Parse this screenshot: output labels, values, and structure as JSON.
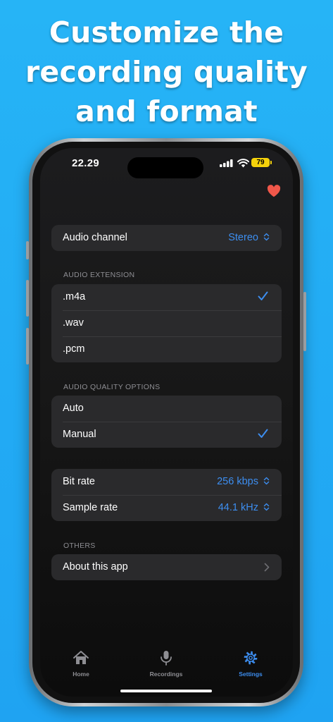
{
  "headline": {
    "line1": "Customize the",
    "line2": "recording quality",
    "line3": "and format"
  },
  "status_bar": {
    "time": "22.29",
    "battery": "79"
  },
  "icons": {
    "favorite": "heart-icon",
    "check": "checkmark-icon",
    "updown": "chevron-up-down-icon",
    "disclosure": "chevron-right-icon"
  },
  "colors": {
    "background": "#26b4f6",
    "accent": "#3d8ef0",
    "heart": "#f0574a",
    "battery": "#f5d20b"
  },
  "settings": {
    "audio_channel": {
      "label": "Audio channel",
      "value": "Stereo"
    },
    "audio_extension": {
      "header": "AUDIO EXTENSION",
      "options": [
        ".m4a",
        ".wav",
        ".pcm"
      ],
      "selected": ".m4a"
    },
    "audio_quality": {
      "header": "AUDIO QUALITY OPTIONS",
      "options": [
        "Auto",
        "Manual"
      ],
      "selected": "Manual"
    },
    "bit_rate": {
      "label": "Bit rate",
      "value": "256 kbps"
    },
    "sample_rate": {
      "label": "Sample rate",
      "value": "44.1 kHz"
    },
    "others": {
      "header": "OTHERS",
      "about_label": "About this app"
    }
  },
  "tabbar": {
    "tabs": [
      {
        "label": "Home",
        "icon": "home-icon",
        "active": false
      },
      {
        "label": "Recordings",
        "icon": "microphone-icon",
        "active": false
      },
      {
        "label": "Settings",
        "icon": "gear-icon",
        "active": true
      }
    ]
  }
}
